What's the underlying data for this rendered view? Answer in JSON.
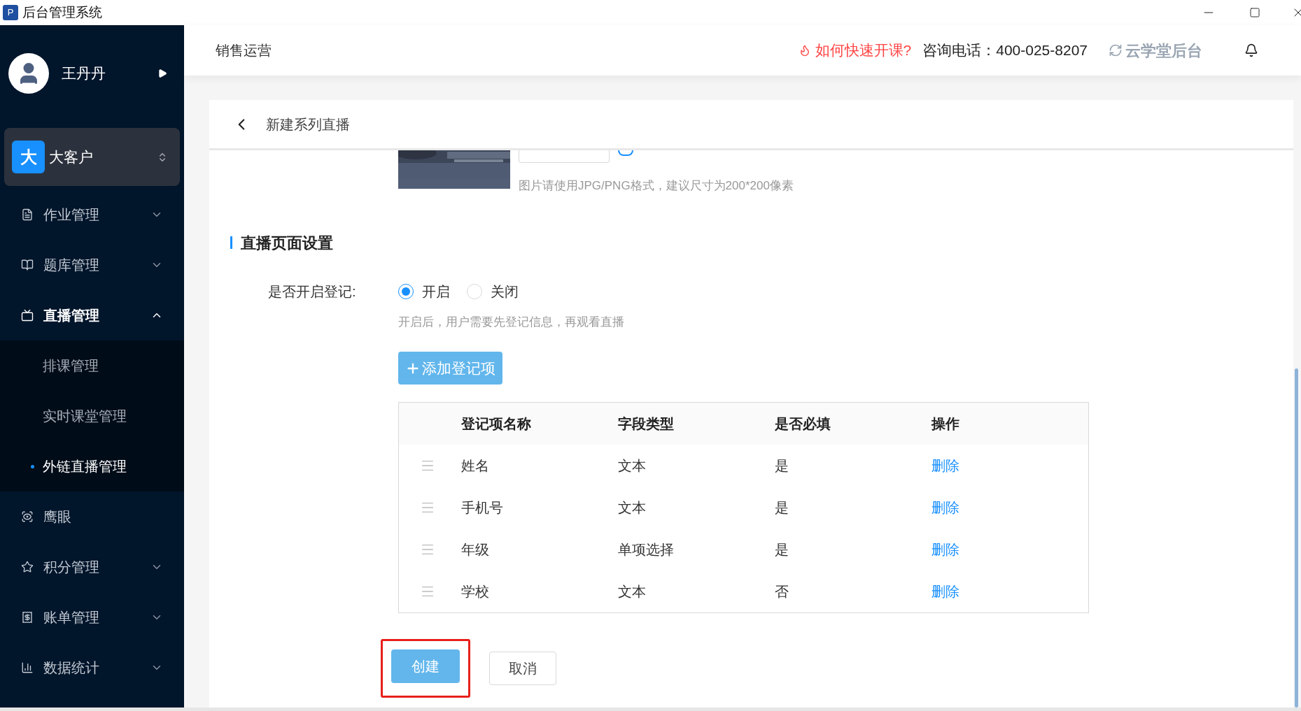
{
  "window": {
    "title": "后台管理系统",
    "app_icon": "P"
  },
  "sidebar": {
    "user": {
      "name": "王丹丹"
    },
    "org": {
      "badge": "大",
      "name": "大客户"
    },
    "items": [
      {
        "kind": "group",
        "label": "作业管理",
        "expanded": false
      },
      {
        "kind": "group",
        "label": "题库管理",
        "expanded": false
      },
      {
        "kind": "group",
        "label": "直播管理",
        "expanded": true,
        "children": [
          {
            "label": "排课管理",
            "selected": false
          },
          {
            "label": "实时课堂管理",
            "selected": false
          },
          {
            "label": "外链直播管理",
            "selected": true
          }
        ]
      },
      {
        "kind": "link",
        "label": "鹰眼"
      },
      {
        "kind": "group",
        "label": "积分管理",
        "expanded": false
      },
      {
        "kind": "group",
        "label": "账单管理",
        "expanded": false
      },
      {
        "kind": "group",
        "label": "数据统计",
        "expanded": false
      }
    ]
  },
  "header": {
    "section": "销售运营",
    "help_link": "如何快速开课?",
    "phone_label": "咨询电话：",
    "phone": "400-025-8207",
    "brand": "云学堂后台"
  },
  "page": {
    "title": "新建系列直播",
    "image_hint": "图片请使用JPG/PNG格式，建议尺寸为200*200像素",
    "section_title": "直播页面设置",
    "registration": {
      "label": "是否开启登记:",
      "options": [
        {
          "label": "开启",
          "selected": true
        },
        {
          "label": "关闭",
          "selected": false
        }
      ],
      "hint": "开启后，用户需要先登记信息，再观看直播"
    },
    "add_button": "添加登记项",
    "table": {
      "columns": [
        "登记项名称",
        "字段类型",
        "是否必填",
        "操作"
      ],
      "rows": [
        {
          "name": "姓名",
          "type": "文本",
          "required": "是",
          "action": "删除"
        },
        {
          "name": "手机号",
          "type": "文本",
          "required": "是",
          "action": "删除"
        },
        {
          "name": "年级",
          "type": "单项选择",
          "required": "是",
          "action": "删除"
        },
        {
          "name": "学校",
          "type": "文本",
          "required": "否",
          "action": "删除"
        }
      ]
    },
    "buttons": [
      {
        "kind": "primary",
        "label": "创建",
        "highlighted": true
      },
      {
        "kind": "default",
        "label": "取消",
        "highlighted": false
      }
    ]
  }
}
